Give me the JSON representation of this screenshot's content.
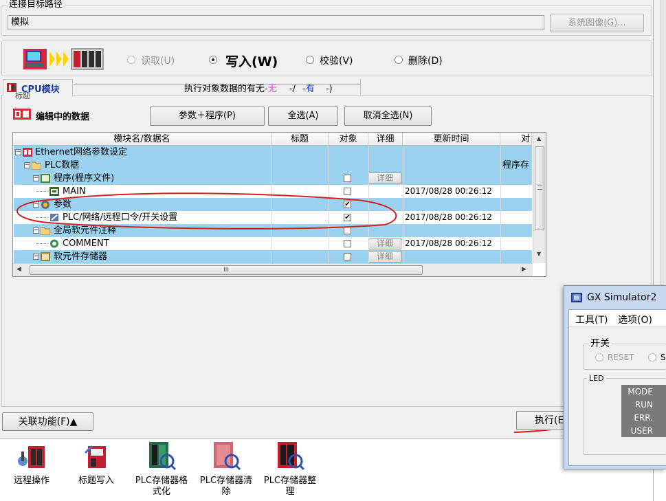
{
  "connection": {
    "group_title": "连接目标路径",
    "path_value": "模拟",
    "system_image_label": "系统图像(G)..."
  },
  "mode": {
    "read_label": "读取(U)",
    "write_label": "写入(W)",
    "verify_label": "校验(V)",
    "delete_label": "删除(D)",
    "selected": "write"
  },
  "tabs": {
    "cpu_module_label": "CPU模块",
    "label_partial": "标题",
    "exec_target_label": "执行对象数据的有无",
    "none_label": "无",
    "has_label": "有",
    "bracket_open": "(",
    "bracket_close": ")",
    "dash": "-",
    "slash": "/"
  },
  "editing": {
    "title": "编辑中的数据",
    "param_program_button": "参数＋程序(P)",
    "select_all_button": "全选(A)",
    "cancel_all_button": "取消全选(N)"
  },
  "table": {
    "headers": [
      "模块名/数据名",
      "标题",
      "对象",
      "详细",
      "更新时间",
      "对"
    ],
    "rows": [
      {
        "name": "Ethernet网络参数设定",
        "title": "",
        "checked": null,
        "detail": "",
        "time": "",
        "extra": ""
      },
      {
        "name": "PLC数据",
        "title": "",
        "checked": null,
        "detail": "",
        "time": "",
        "extra": "程序存"
      },
      {
        "name": "程序(程序文件)",
        "title": "",
        "checked": false,
        "detail": "详细",
        "time": "",
        "extra": ""
      },
      {
        "name": "MAIN",
        "title": "",
        "checked": false,
        "detail": "",
        "time": "2017/08/28 00:26:12",
        "extra": ""
      },
      {
        "name": "参数",
        "title": "",
        "checked": true,
        "detail": "",
        "time": "",
        "extra": ""
      },
      {
        "name": "PLC/网络/远程口令/开关设置",
        "title": "",
        "checked": true,
        "detail": "",
        "time": "2017/08/28 00:26:12",
        "extra": ""
      },
      {
        "name": "全局软元件注释",
        "title": "",
        "checked": false,
        "detail": "",
        "time": "",
        "extra": ""
      },
      {
        "name": "COMMENT",
        "title": "",
        "checked": false,
        "detail": "详细",
        "time": "2017/08/28 00:26:12",
        "extra": ""
      },
      {
        "name": "软元件存储器",
        "title": "",
        "checked": false,
        "detail": "详细",
        "time": "",
        "extra": ""
      }
    ],
    "hscroll_grip": "III"
  },
  "footer": {
    "related_button": "关联功能(F)▲",
    "execute_button": "执行(E"
  },
  "bottom_tools": [
    {
      "label_line1": "远程操作",
      "label_line2": ""
    },
    {
      "label_line1": "标题写入",
      "label_line2": ""
    },
    {
      "label_line1": "PLC存储器格",
      "label_line2": "式化"
    },
    {
      "label_line1": "PLC存储器清",
      "label_line2": "除"
    },
    {
      "label_line1": "PLC存储器整",
      "label_line2": "理"
    }
  ],
  "simulator": {
    "title": "GX Simulator2",
    "menu_tools": "工具(T)",
    "menu_options": "选项(O)",
    "switch_group": "开关",
    "reset_label": "RESET",
    "s_label": "S",
    "led_group": "LED",
    "led_labels": [
      "MODE",
      "RUN",
      "ERR.",
      "USER"
    ]
  },
  "colors": {
    "row_highlight": "#9ad2f0",
    "annotation_red": "#d42020",
    "none_pink": "#e040e0",
    "has_blue": "#2040c0"
  }
}
